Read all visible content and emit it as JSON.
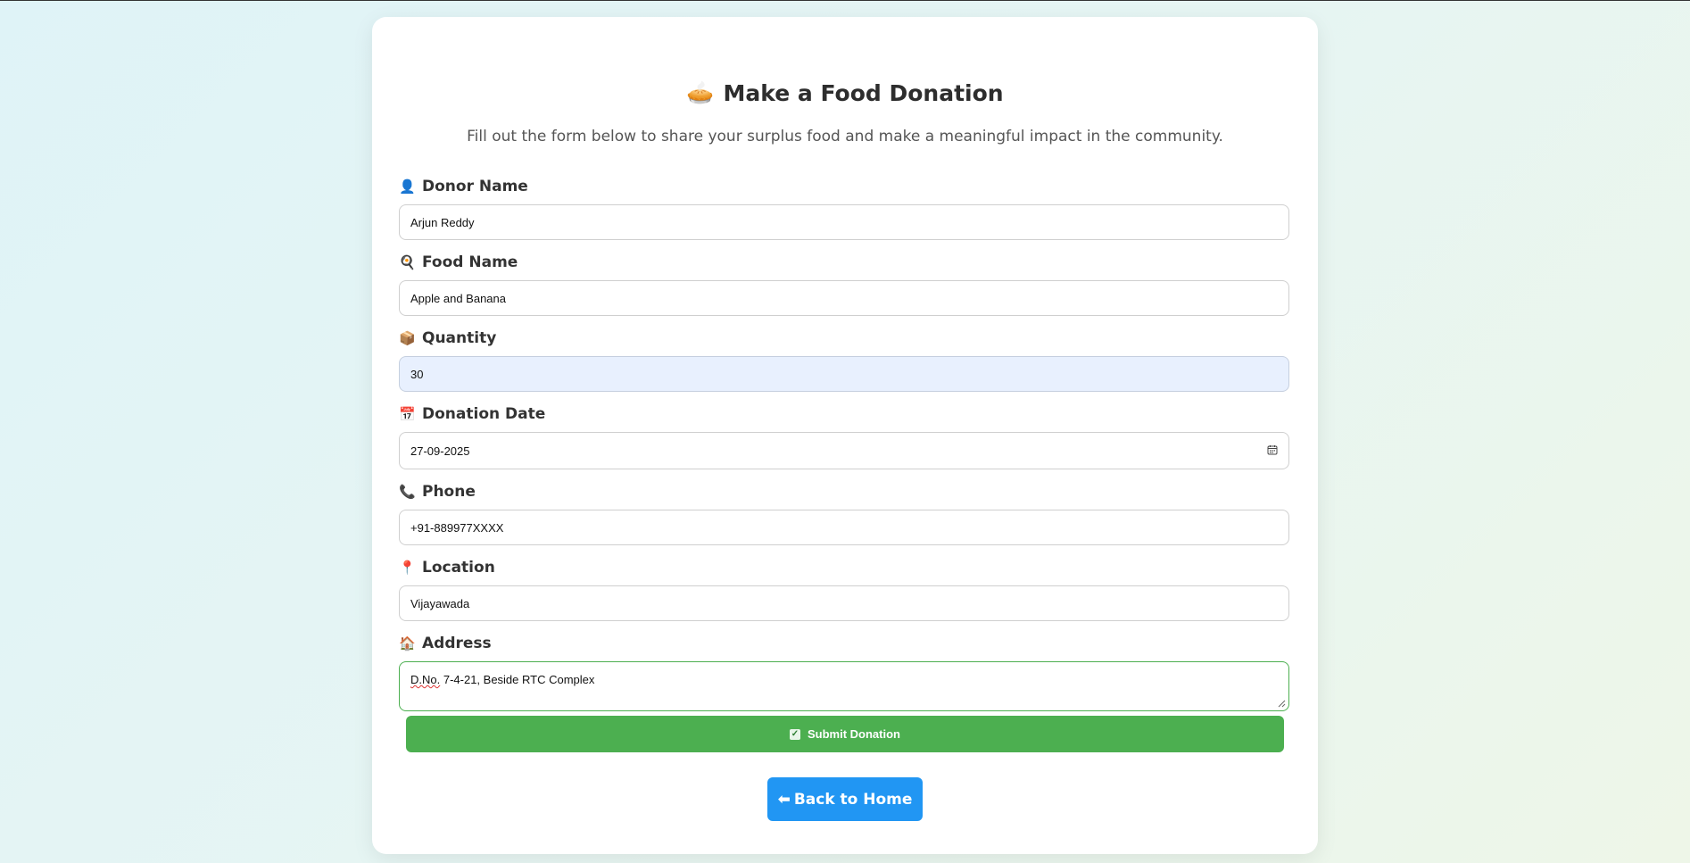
{
  "header": {
    "icon": "🥧",
    "title": "Make a Food Donation",
    "subtitle": "Fill out the form below to share your surplus food and make a meaningful impact in the community."
  },
  "form": {
    "donor_name": {
      "icon": "👤",
      "label": "Donor Name",
      "value": "Arjun Reddy"
    },
    "food_name": {
      "icon": "🍳",
      "label": "Food Name",
      "value": "Apple and Banana"
    },
    "quantity": {
      "icon": "📦",
      "label": "Quantity",
      "value": "30"
    },
    "donation_date": {
      "icon": "📅",
      "label": "Donation Date",
      "value": "27-09-2025"
    },
    "phone": {
      "icon": "📞",
      "label": "Phone",
      "value": "+91-889977XXXX"
    },
    "location": {
      "icon": "📍",
      "label": "Location",
      "value": "Vijayawada"
    },
    "address": {
      "icon": "🏠",
      "label": "Address",
      "value_part1": "D.No.",
      "value_part2": " 7-4-21, Beside RTC Complex"
    }
  },
  "buttons": {
    "submit_icon": "✓",
    "submit_label": "Submit Donation",
    "home_icon": "⬅",
    "home_label": "Back to Home"
  },
  "colors": {
    "submit": "#4caf50",
    "home": "#2196f3",
    "active_input": "#e8f0fe"
  }
}
